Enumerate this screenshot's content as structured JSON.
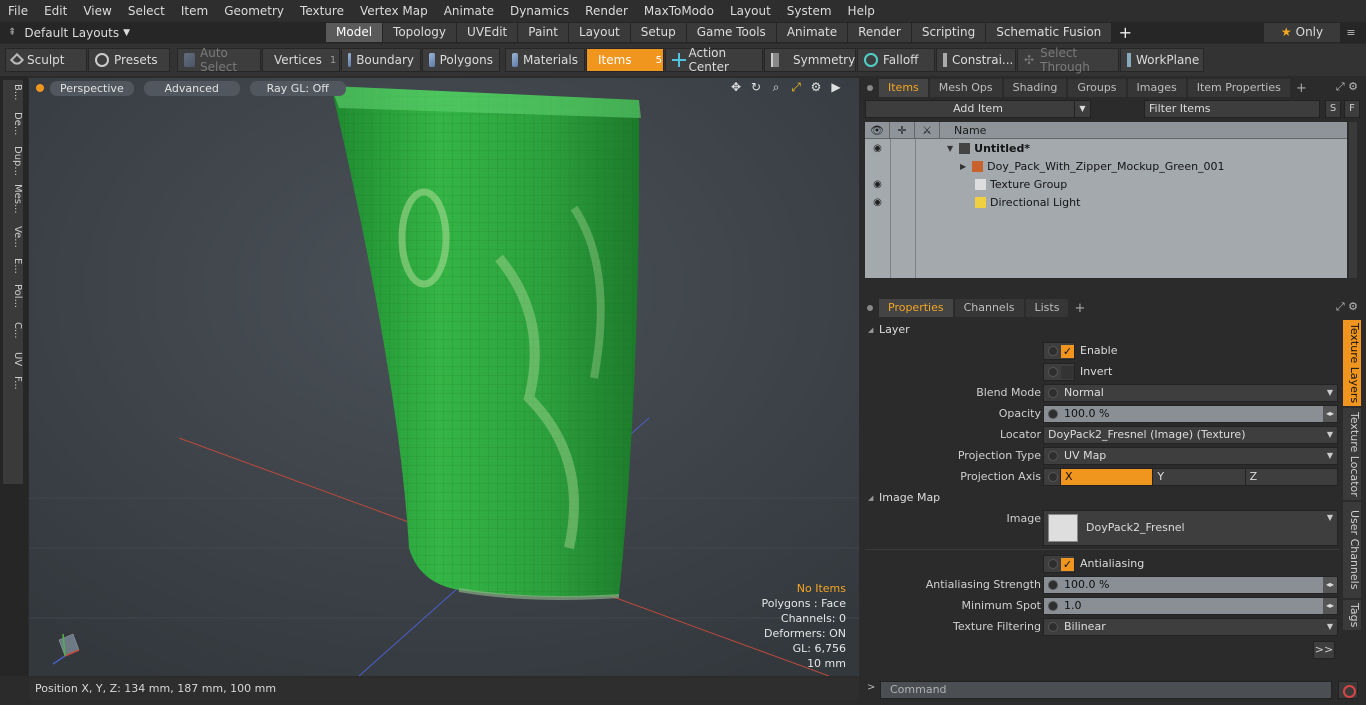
{
  "menu": [
    "File",
    "Edit",
    "View",
    "Select",
    "Item",
    "Geometry",
    "Texture",
    "Vertex Map",
    "Animate",
    "Dynamics",
    "Render",
    "MaxToModo",
    "Layout",
    "System",
    "Help"
  ],
  "layout_selector": "Default Layouts",
  "layout_tabs": [
    {
      "label": "Model",
      "active": true
    },
    {
      "label": "Topology"
    },
    {
      "label": "UVEdit"
    },
    {
      "label": "Paint"
    },
    {
      "label": "Layout"
    },
    {
      "label": "Setup"
    },
    {
      "label": "Game Tools"
    },
    {
      "label": "Animate"
    },
    {
      "label": "Render"
    },
    {
      "label": "Scripting"
    },
    {
      "label": "Schematic Fusion"
    }
  ],
  "layout_plus": "+",
  "only_label": "Only",
  "toolbar": {
    "sculpt": "Sculpt",
    "presets": "Presets",
    "auto_select": "Auto Select",
    "vertices": "Vertices",
    "vertices_count": "1",
    "boundary": "Boundary",
    "polygons": "Polygons",
    "materials": "Materials",
    "items": "Items",
    "items_count": "5",
    "action_center": "Action Center",
    "symmetry": "Symmetry",
    "falloff": "Falloff",
    "constraints": "Constrai...",
    "select_through": "Select Through",
    "workplane": "WorkPlane"
  },
  "left_tabs": [
    "B...",
    "De...",
    "Dup...",
    "Mes...",
    "Ve...",
    "E...",
    "Pol...",
    "C...",
    "UV",
    "F..."
  ],
  "viewport": {
    "view_mode": "Perspective",
    "shading": "Advanced",
    "raygl": "Ray GL: Off",
    "info": {
      "selection": "No Items",
      "polygons": "Polygons : Face",
      "channels": "Channels: 0",
      "deformers": "Deformers: ON",
      "gl": "GL: 6,756",
      "scale": "10 mm"
    }
  },
  "status": {
    "position": "Position X, Y, Z:   134 mm, 187 mm, 100 mm"
  },
  "items_panel": {
    "tabs": [
      {
        "label": "Items",
        "active": true
      },
      {
        "label": "Mesh Ops"
      },
      {
        "label": "Shading"
      },
      {
        "label": "Groups"
      },
      {
        "label": "Images"
      },
      {
        "label": "Item Properties"
      }
    ],
    "tab_plus": "+",
    "add_item": "Add Item",
    "filter_placeholder": "Filter Items",
    "s_btn": "S",
    "f_btn": "F",
    "col_name": "Name",
    "tree": [
      {
        "label": "Untitled*",
        "level": 0,
        "bold": true,
        "eye": true
      },
      {
        "label": "Doy_Pack_With_Zipper_Mockup_Green_001",
        "level": 1,
        "eye": false
      },
      {
        "label": "Texture Group",
        "level": 1,
        "eye": true
      },
      {
        "label": "Directional Light",
        "level": 1,
        "eye": true
      }
    ]
  },
  "properties_panel": {
    "tabs": [
      {
        "label": "Properties",
        "active": true
      },
      {
        "label": "Channels"
      },
      {
        "label": "Lists"
      }
    ],
    "tab_plus": "+",
    "section_layer": "Layer",
    "enable": "Enable",
    "invert": "Invert",
    "blend_mode_label": "Blend Mode",
    "blend_mode": "Normal",
    "opacity_label": "Opacity",
    "opacity": "100.0 %",
    "locator_label": "Locator",
    "locator": "DoyPack2_Fresnel (Image) (Texture)",
    "projection_type_label": "Projection Type",
    "projection_type": "UV Map",
    "projection_axis_label": "Projection Axis",
    "axes": [
      "X",
      "Y",
      "Z"
    ],
    "section_image_map": "Image Map",
    "image_label": "Image",
    "image": "DoyPack2_Fresnel",
    "antialiasing": "Antialiasing",
    "aa_strength_label": "Antialiasing Strength",
    "aa_strength": "100.0 %",
    "min_spot_label": "Minimum Spot",
    "min_spot": "1.0",
    "tex_filter_label": "Texture Filtering",
    "tex_filter": "Bilinear",
    "more": ">>"
  },
  "side_tabs": [
    {
      "label": "Texture Layers",
      "active": true
    },
    {
      "label": "Texture Locator"
    },
    {
      "label": "User Channels"
    },
    {
      "label": "Tags"
    }
  ],
  "command_placeholder": "Command",
  "colors": {
    "accent": "#f0951e",
    "viewport_bg": "#3b4046",
    "pack_green": "#2fa640"
  }
}
